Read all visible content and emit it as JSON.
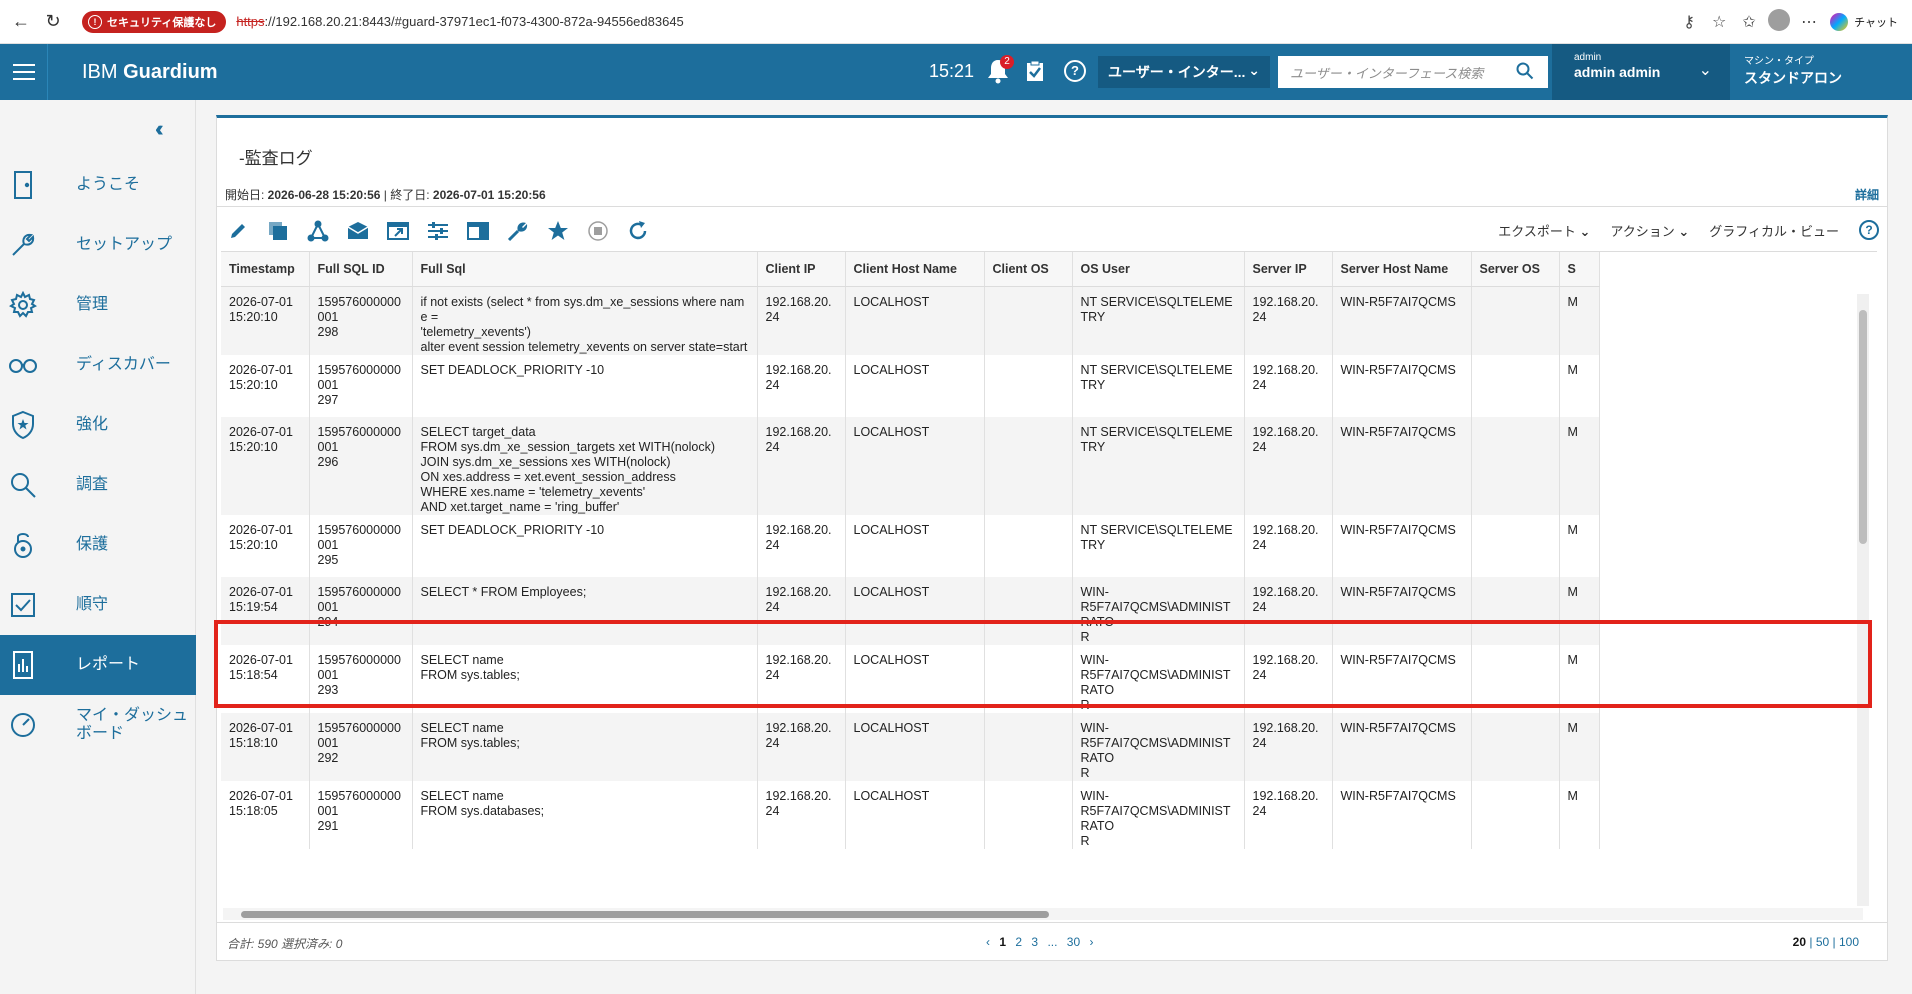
{
  "browser": {
    "security_label": "セキュリティ保護なし",
    "url_scheme": "https",
    "url_rest": "://192.168.20.21:8443/#guard-37971ec1-f073-4300-872a-94556ed83645",
    "chat_label": "チャット"
  },
  "header": {
    "brand_prefix": "IBM ",
    "brand_name": "Guardium",
    "time": "15:21",
    "notification_count": "2",
    "ui_select": "ユーザー・インター...",
    "search_placeholder": "ユーザー・インターフェース検索",
    "user_small": "admin",
    "user_big": "admin admin",
    "machine_small": "マシン・タイプ",
    "machine_big": "スタンドアロン"
  },
  "sidebar": {
    "items": [
      {
        "label": "ようこそ",
        "icon": "door-icon"
      },
      {
        "label": "セットアップ",
        "icon": "wrench-icon"
      },
      {
        "label": "管理",
        "icon": "gear-icon"
      },
      {
        "label": "ディスカバー",
        "icon": "binoculars-icon"
      },
      {
        "label": "強化",
        "icon": "shield-star-icon"
      },
      {
        "label": "調査",
        "icon": "search-icon"
      },
      {
        "label": "保護",
        "icon": "lock-icon"
      },
      {
        "label": "順守",
        "icon": "checkbox-icon"
      },
      {
        "label": "レポート",
        "icon": "report-icon"
      },
      {
        "label": "マイ・ダッシュボード",
        "icon": "dashboard-icon"
      }
    ]
  },
  "panel": {
    "title": "-監査ログ",
    "date_range_prefix": "開始日: ",
    "start_date": "2026-06-28 15:20:56",
    "date_sep": " | 終了日: ",
    "end_date": "2026-07-01 15:20:56",
    "detail_link": "詳細",
    "export_label": "エクスポート",
    "action_label": "アクション",
    "graphical_view": "グラフィカル・ビュー"
  },
  "table": {
    "columns": [
      "Timestamp",
      "Full SQL ID",
      "Full Sql",
      "Client IP",
      "Client Host Name",
      "Client OS",
      "OS User",
      "Server IP",
      "Server Host Name",
      "Server OS",
      "S"
    ],
    "rows": [
      {
        "ts": "2026-07-01\n15:20:10",
        "id": "159576000000001\n298",
        "sql": "if not exists (select * from sys.dm_xe_sessions where name =\n'telemetry_xevents')\nalter event session telemetry_xevents on server state=start",
        "cip": "192.168.20.24",
        "chost": "LOCALHOST",
        "cos": "",
        "osuser": "NT SERVICE\\SQLTELEMETRY",
        "sip": "192.168.20.24",
        "shost": "WIN-R5F7AI7QCMS",
        "sos": "",
        "s": "M"
      },
      {
        "ts": "2026-07-01\n15:20:10",
        "id": "159576000000001\n297",
        "sql": "SET DEADLOCK_PRIORITY -10",
        "cip": "192.168.20.24",
        "chost": "LOCALHOST",
        "cos": "",
        "osuser": "NT SERVICE\\SQLTELEMETRY",
        "sip": "192.168.20.24",
        "shost": "WIN-R5F7AI7QCMS",
        "sos": "",
        "s": "M"
      },
      {
        "ts": "2026-07-01\n15:20:10",
        "id": "159576000000001\n296",
        "sql": "SELECT target_data\nFROM sys.dm_xe_session_targets xet WITH(nolock)\nJOIN sys.dm_xe_sessions xes WITH(nolock)\nON xes.address = xet.event_session_address\nWHERE xes.name = 'telemetry_xevents'\nAND xet.target_name = 'ring_buffer'",
        "cip": "192.168.20.24",
        "chost": "LOCALHOST",
        "cos": "",
        "osuser": "NT SERVICE\\SQLTELEMETRY",
        "sip": "192.168.20.24",
        "shost": "WIN-R5F7AI7QCMS",
        "sos": "",
        "s": "M"
      },
      {
        "ts": "2026-07-01\n15:20:10",
        "id": "159576000000001\n295",
        "sql": "SET DEADLOCK_PRIORITY -10",
        "cip": "192.168.20.24",
        "chost": "LOCALHOST",
        "cos": "",
        "osuser": "NT SERVICE\\SQLTELEMETRY",
        "sip": "192.168.20.24",
        "shost": "WIN-R5F7AI7QCMS",
        "sos": "",
        "s": "M"
      },
      {
        "ts": "2026-07-01\n15:19:54",
        "id": "159576000000001\n294",
        "sql": "SELECT * FROM Employees;",
        "cip": "192.168.20.24",
        "chost": "LOCALHOST",
        "cos": "",
        "osuser": "WIN-\nR5F7AI7QCMS\\ADMINISTRATO\nR",
        "sip": "192.168.20.24",
        "shost": "WIN-R5F7AI7QCMS",
        "sos": "",
        "s": "M"
      },
      {
        "ts": "2026-07-01\n15:18:54",
        "id": "159576000000001\n293",
        "sql": "SELECT name\nFROM sys.tables;",
        "cip": "192.168.20.24",
        "chost": "LOCALHOST",
        "cos": "",
        "osuser": "WIN-\nR5F7AI7QCMS\\ADMINISTRATO\nR",
        "sip": "192.168.20.24",
        "shost": "WIN-R5F7AI7QCMS",
        "sos": "",
        "s": "M"
      },
      {
        "ts": "2026-07-01\n15:18:10",
        "id": "159576000000001\n292",
        "sql": "SELECT name\nFROM sys.tables;",
        "cip": "192.168.20.24",
        "chost": "LOCALHOST",
        "cos": "",
        "osuser": "WIN-\nR5F7AI7QCMS\\ADMINISTRATO\nR",
        "sip": "192.168.20.24",
        "shost": "WIN-R5F7AI7QCMS",
        "sos": "",
        "s": "M"
      },
      {
        "ts": "2026-07-01\n15:18:05",
        "id": "159576000000001\n291",
        "sql": "SELECT name\nFROM sys.databases;",
        "cip": "192.168.20.24",
        "chost": "LOCALHOST",
        "cos": "",
        "osuser": "WIN-\nR5F7AI7QCMS\\ADMINISTRATO\nR",
        "sip": "192.168.20.24",
        "shost": "WIN-R5F7AI7QCMS",
        "sos": "",
        "s": "M"
      }
    ]
  },
  "footer": {
    "total": "合計: 590 選択済み: 0",
    "pages": [
      "1",
      "2",
      "3",
      "...",
      "30"
    ],
    "sizes": [
      "20",
      "50",
      "100"
    ]
  },
  "colors": {
    "brand": "#1d6e9c",
    "highlight": "#e2231a",
    "security_badge": "#c5221f"
  }
}
